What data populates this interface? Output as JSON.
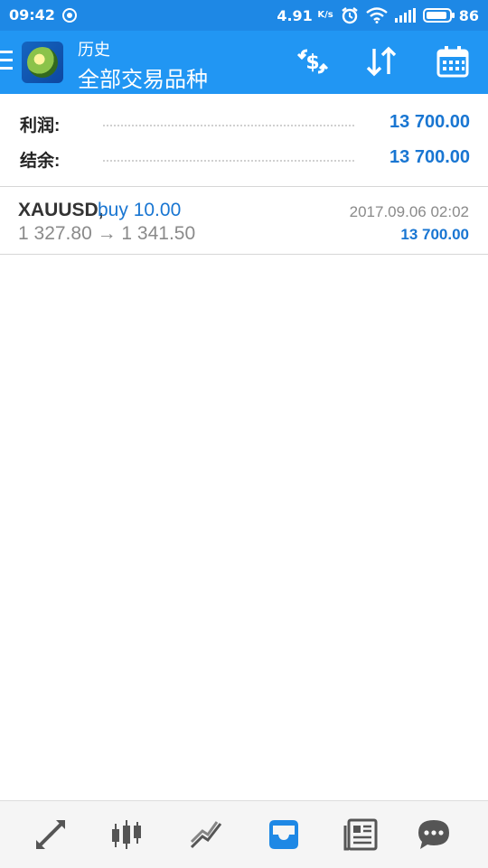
{
  "status_bar": {
    "time": "09:42",
    "speed": "4.91",
    "speed_unit": "K/s",
    "battery": "86"
  },
  "app_bar": {
    "title": "历史",
    "subtitle": "全部交易品种",
    "accent_color": "#2196f3"
  },
  "summary": {
    "profit_label": "利润:",
    "profit_value": "13 700.00",
    "balance_label": "结余:",
    "balance_value": "13 700.00"
  },
  "trades": [
    {
      "symbol": "XAUUSD,",
      "side": "buy 10.00",
      "prices": "1 327.80 → 1 341.50",
      "datetime": "2017.09.06 02:02",
      "profit": "13 700.00"
    }
  ],
  "bottom_nav": {
    "items": [
      "quotes-icon",
      "chart-icon",
      "trade-icon",
      "history-icon",
      "news-icon",
      "chat-icon"
    ],
    "active": "history-icon",
    "active_color": "#1e88e5",
    "inactive_color": "#555555"
  }
}
